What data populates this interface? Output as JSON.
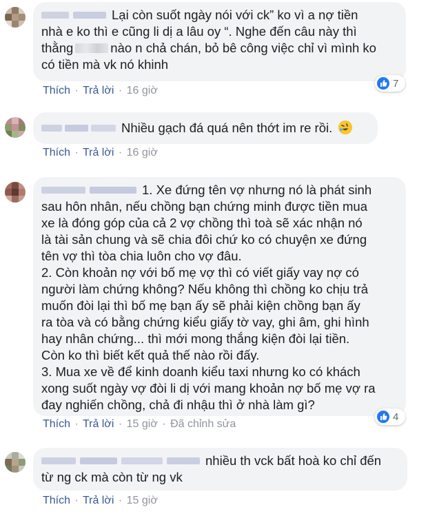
{
  "actions": {
    "like": "Thích",
    "reply": "Trả lời",
    "separator": "·"
  },
  "comments": [
    {
      "lines": [
        "Lại còn suốt ngày nói với ck” ko vì a nợ tiền",
        "nhà e ko thì e cũng li dị a lâu oy “. Nghe đến câu này thì",
        "nào n chả chán, bỏ bê công việc chỉ vì mình ko",
        "có tiền mà vk nó khinh"
      ],
      "line3_prefix": "thằng",
      "time": "16 giờ",
      "reactions": {
        "icon": "like-icon",
        "count": "7"
      }
    },
    {
      "lines": [
        "Nhiều gạch đá quá nên thớt im re rồi."
      ],
      "emoji": "rolling-laughing-emoji",
      "time": "16 giờ"
    },
    {
      "lines": [
        "1. Xe đứng tên vợ nhưng nó là phát sinh",
        "sau hôn nhân, nếu chồng bạn chứng minh được tiền mua",
        "xe là đóng góp của cả 2 vợ chồng thì toà sẽ xác nhận nó",
        "là tài sản chung và sẽ chia đôi chứ ko có chuyện xe đứng",
        "tên vợ thì tòa chia luôn cho vợ đâu.",
        "2. Còn khoản nợ với bố mẹ vợ thì có viết giấy vay nợ có",
        "người làm chứng không? Nếu không thì chồng ko chịu trả",
        "muốn đòi lại thì bố mẹ bạn ấy sẽ phải kiện chồng bạn ấy",
        "ra tòa và có bằng chứng kiểu giấy tờ vay, ghi âm, ghi hình",
        "hay nhân chứng... thì mới mong thắng kiện đòi lại tiền.",
        "Còn ko thì biết kết quả thế nào rồi đấy.",
        "3. Mua xe về để kinh doanh kiểu taxi nhưng ko có khách",
        "xong suốt ngày vợ đòi li dị với mang khoản nợ bố mẹ vợ ra",
        "đay nghiến chồng, chả đi nhậu thì ở nhà làm gì?"
      ],
      "time": "15 giờ",
      "edited": "Đã chỉnh sửa",
      "reactions": {
        "icon": "like-icon",
        "count": "4"
      }
    },
    {
      "lines": [
        "nhiều th vck bất hoà ko chỉ đến",
        "từ ng ck mà còn từ ng vk"
      ],
      "time": "15 giờ"
    }
  ],
  "colors": {
    "bubble": "#f2f3f5",
    "link": "#385898",
    "meta": "#90949c",
    "like_blue": "#2078f4"
  }
}
